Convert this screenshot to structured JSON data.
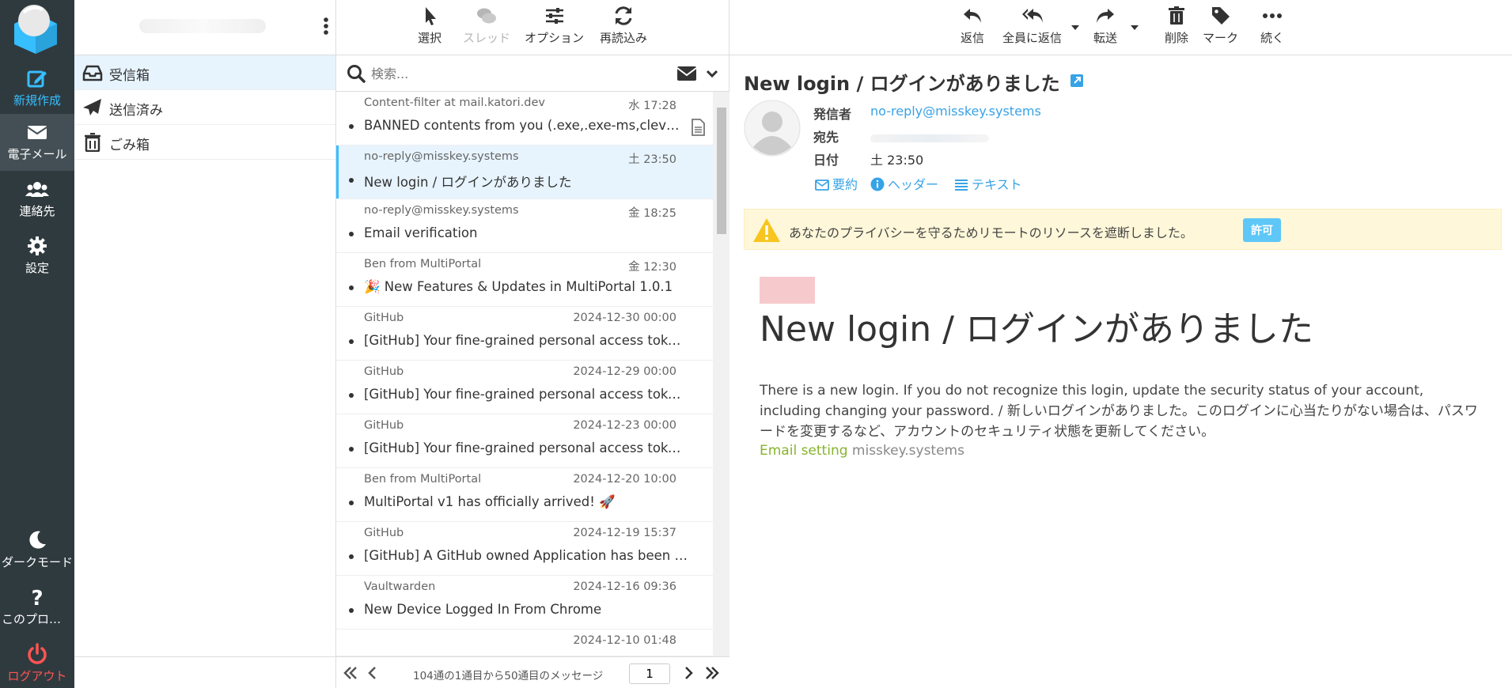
{
  "rail": {
    "items": [
      {
        "label": "新規作成"
      },
      {
        "label": "電子メール"
      },
      {
        "label": "連絡先"
      },
      {
        "label": "設定"
      },
      {
        "label": "ダークモード"
      },
      {
        "label": "このプログラムについて"
      },
      {
        "label": "ログアウト"
      }
    ]
  },
  "folders": [
    {
      "label": "受信箱"
    },
    {
      "label": "送信済み"
    },
    {
      "label": "ごみ箱"
    }
  ],
  "list_toolbar": {
    "select": "選択",
    "thread": "スレッド",
    "options": "オプション",
    "refresh": "再読込み"
  },
  "search": {
    "placeholder": "検索..."
  },
  "messages": [
    {
      "from": "Content-filter at mail.katori.dev",
      "date": "水 17:28",
      "subject": "BANNED contents from you (.exe,.exe-ms,cleverg..."
    },
    {
      "from": "no-reply@misskey.systems",
      "date": "土 23:50",
      "subject": "New login / ログインがありました"
    },
    {
      "from": "no-reply@misskey.systems",
      "date": "金 18:25",
      "subject": "Email verification"
    },
    {
      "from": "Ben from MultiPortal",
      "date": "金 12:30",
      "subject": "🎉 New Features & Updates in MultiPortal 1.0.1"
    },
    {
      "from": "GitHub",
      "date": "2024-12-30 00:00",
      "subject": "[GitHub] Your fine-grained personal access token ..."
    },
    {
      "from": "GitHub",
      "date": "2024-12-29 00:00",
      "subject": "[GitHub] Your fine-grained personal access token ..."
    },
    {
      "from": "GitHub",
      "date": "2024-12-23 00:00",
      "subject": "[GitHub] Your fine-grained personal access token ..."
    },
    {
      "from": "Ben from MultiPortal",
      "date": "2024-12-20 10:00",
      "subject": "MultiPortal v1 has officially arrived! 🚀"
    },
    {
      "from": "GitHub",
      "date": "2024-12-19 15:37",
      "subject": "[GitHub] A GitHub owned Application has been ad..."
    },
    {
      "from": "Vaultwarden",
      "date": "2024-12-16 09:36",
      "subject": "New Device Logged In From Chrome"
    },
    {
      "from": "",
      "date": "2024-12-10 01:48",
      "subject": ""
    }
  ],
  "pager": {
    "text": "104通の1通目から50通目のメッセージ",
    "page": "1"
  },
  "reader_toolbar": {
    "reply": "返信",
    "reply_all": "全員に返信",
    "forward": "転送",
    "delete": "削除",
    "mark": "マーク",
    "more": "続く"
  },
  "message": {
    "title": "New login / ログインがありました",
    "from_label": "発信者",
    "from": "no-reply@misskey.systems",
    "to_label": "宛先",
    "date_label": "日付",
    "date": "土 23:50",
    "links": {
      "summary": "要約",
      "headers": "ヘッダー",
      "plain": "テキスト"
    },
    "privacy_notice": "あなたのプライバシーを守るためリモートのリソースを遮断しました。",
    "allow": "許可",
    "heading": "New login / ログインがありました",
    "body": "There is a new login. If you do not recognize this login, update the security status of your account, including changing your password. / 新しいログインがありました。このログインに心当たりがない場合は、パスワードを変更するなど、アカウントのセキュリティ状態を更新してください。",
    "footer_link": "Email setting",
    "footer_host": "misskey.systems"
  },
  "colors": {
    "rail_bg": "#2f3a3f",
    "accent": "#37beff",
    "logout": "#ff5552",
    "selected_bg": "#e7f4fd",
    "warning_bg": "#fff7d9",
    "footer_link": "#86b32d"
  }
}
